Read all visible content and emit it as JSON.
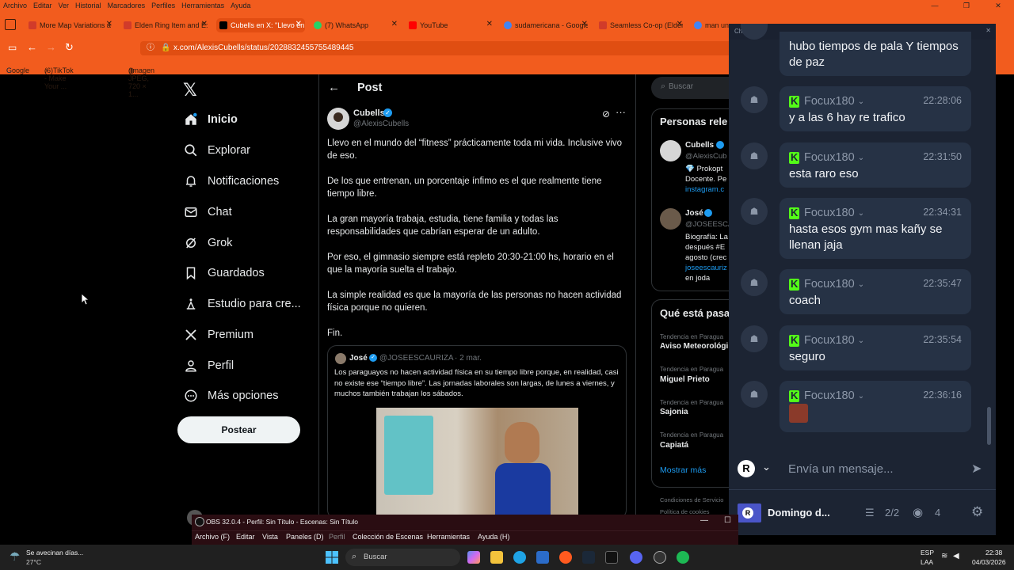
{
  "menubar": {
    "items": [
      "Archivo",
      "Editar",
      "Ver",
      "Historial",
      "Marcadores",
      "Perfiles",
      "Herramientas",
      "Ayuda"
    ]
  },
  "tabs": [
    {
      "label": "More Map Variations a",
      "color": "#d13b2a"
    },
    {
      "label": "Elden Ring Item and E:",
      "color": "#d13b2a"
    },
    {
      "label": "Cubells en X: \"Llevo en",
      "color": "#000000"
    },
    {
      "label": "(7) WhatsApp",
      "color": "#25d366"
    },
    {
      "label": "YouTube",
      "color": "#ff0000"
    },
    {
      "label": "sudamericana - Google",
      "color": "#4285f4"
    },
    {
      "label": "Seamless Co-op (Elden",
      "color": "#d13b2a"
    },
    {
      "label": "man unit",
      "color": "#4285f4"
    }
  ],
  "url": "x.com/AlexisCubells/status/2028832455755489445",
  "bookmarks": [
    "Google",
    "(6)TikTok - Make Your ...",
    "(Imagen JPEG, 720 × 1..."
  ],
  "xnav": {
    "items": [
      {
        "label": "Inicio",
        "icon": "home-icon"
      },
      {
        "label": "Explorar",
        "icon": "search-icon"
      },
      {
        "label": "Notificaciones",
        "icon": "bell-icon"
      },
      {
        "label": "Chat",
        "icon": "mail-icon"
      },
      {
        "label": "Grok",
        "icon": "grok-icon"
      },
      {
        "label": "Guardados",
        "icon": "bookmark-icon"
      },
      {
        "label": "Estudio para cre...",
        "icon": "studio-icon"
      },
      {
        "label": "Premium",
        "icon": "x-logo-icon"
      },
      {
        "label": "Perfil",
        "icon": "person-icon"
      },
      {
        "label": "Más opciones",
        "icon": "more-icon"
      }
    ],
    "post_button": "Postear"
  },
  "post": {
    "header": "Post",
    "author_name": "Cubells",
    "author_handle": "@AlexisCubells",
    "paragraphs": [
      "Llevo en el mundo del “fitness” prácticamente toda mi vida. Inclusive vivo de eso.",
      "De los que entrenan, un porcentaje ínfimo es el que realmente tiene tiempo libre.",
      "La gran mayoría trabaja, estudia, tiene familia y todas las responsabilidades que cabrían esperar de un adulto.",
      "Por eso, el gimnasio siempre está repleto 20:30-21:00 hs, horario en el que la mayoría suelta el trabajo.",
      "La simple realidad es que la mayoría de las personas no hacen actividad física porque no quieren.",
      "Fin."
    ],
    "quote": {
      "name": "José",
      "handle": "@JOSEESCAURIZA",
      "date": "· 2 mar.",
      "text": "Los paraguayos no hacen actividad física en su tiempo libre porque, en realidad, casi no existe ese “tiempo libre”. Las jornadas laborales son largas, de lunes a viernes, y muchos también trabajan los sábados."
    }
  },
  "right": {
    "search_placeholder": "Buscar",
    "people_title": "Personas rele",
    "person1": {
      "name": "Cubells",
      "handle": "@AlexisCub",
      "bio1": "💎 Prokopt",
      "bio2": "Docente. Pe",
      "link": "instagram.c"
    },
    "person2": {
      "name": "José",
      "handle": "@JOSEESCA",
      "bio1": "Biografía: La",
      "bio2": "después #E",
      "bio3": "agosto (crec",
      "link": "joseescauriz",
      "bio4": "en joda"
    },
    "trending_title": "Qué está pasa",
    "trends": [
      {
        "label": "Tendencia en Paragua",
        "name": "Aviso Meteorológi"
      },
      {
        "label": "Tendencia en Paragua",
        "name": "Miguel Prieto"
      },
      {
        "label": "Tendencia en Paragua",
        "name": "Sajonia"
      },
      {
        "label": "Tendencia en Paragua",
        "name": "Capiatá"
      }
    ],
    "show_more": "Mostrar más",
    "footer1": "Condiciones de Servicio",
    "footer2": "Política de cookies"
  },
  "chat": {
    "title": "Chat",
    "first_message": "hubo tiempos de pala Y tiempos de paz",
    "messages": [
      {
        "user": "Focux180",
        "time": "22:28:06",
        "text": "y a las 6 hay re trafico"
      },
      {
        "user": "Focux180",
        "time": "22:31:50",
        "text": "esta raro eso"
      },
      {
        "user": "Focux180",
        "time": "22:34:31",
        "text": "hasta esos gym mas kañy se llenan jaja"
      },
      {
        "user": "Focux180",
        "time": "22:35:47",
        "text": "coach"
      },
      {
        "user": "Focux180",
        "time": "22:35:54",
        "text": "seguro"
      },
      {
        "user": "Focux180",
        "time": "22:36:16",
        "text": ""
      }
    ],
    "input_placeholder": "Envía un mensaje...",
    "stream_title": "Domingo d...",
    "viewers_ratio": "2/2",
    "viewers": "4"
  },
  "obs": {
    "title": "OBS 32.0.4 - Perfil: Sin Título - Escenas: Sin Título",
    "menu": [
      "Archivo (F)",
      "Editar",
      "Vista",
      "Paneles (D)",
      "Perfil",
      "Colección de Escenas",
      "Herramientas",
      "Ayuda (H)"
    ]
  },
  "taskbar": {
    "weather_line1": "Se avecinan días...",
    "weather_line2": "27°C",
    "search": "Buscar",
    "lang1": "ESP",
    "lang2": "LAA",
    "time": "22:38",
    "date": "04/03/2026"
  }
}
